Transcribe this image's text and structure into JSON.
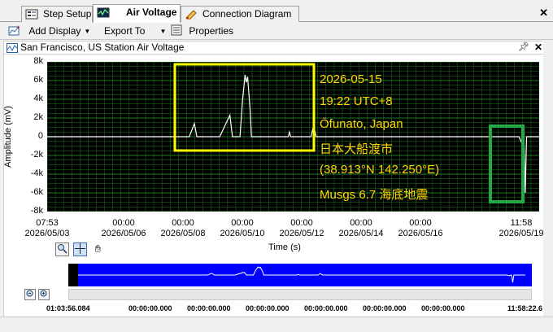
{
  "tabs": [
    {
      "label": "Step Setup",
      "icon": "step-setup-icon",
      "active": false
    },
    {
      "label": "Air Voltage",
      "icon": "air-voltage-icon",
      "active": true
    },
    {
      "label": "Connection Diagram",
      "icon": "connection-diagram-icon",
      "active": false
    }
  ],
  "toolbar": {
    "add_display": "Add Display",
    "export_to": "Export To",
    "properties": "Properties"
  },
  "panel": {
    "title": "San Francisco, US Station Air Voltage"
  },
  "chart_data": {
    "type": "line",
    "xlabel": "Time (s)",
    "ylabel": "Amplitude (mV)",
    "ylim": [
      -8000,
      8000
    ],
    "y_ticks": [
      "8k",
      "6k",
      "4k",
      "2k",
      "0",
      "-2k",
      "-4k",
      "-6k",
      "-8k"
    ],
    "x_ticks": [
      {
        "time": "07:53",
        "date": "2026/05/03"
      },
      {
        "time": "00:00",
        "date": "2026/05/06"
      },
      {
        "time": "00:00",
        "date": "2026/05/08"
      },
      {
        "time": "00:00",
        "date": "2026/05/10"
      },
      {
        "time": "00:00",
        "date": "2026/05/12"
      },
      {
        "time": "00:00",
        "date": "2026/05/14"
      },
      {
        "time": "00:00",
        "date": "2026/05/16"
      },
      {
        "time": "11:58",
        "date": "2026/05/19"
      }
    ],
    "grid": true,
    "line_color": "#ffffff",
    "background": "#000000",
    "grid_color": "#1f7a1f",
    "series": [
      {
        "points": [
          [
            "2026-05-03 07:53",
            0
          ],
          [
            "2026-05-05 00:00",
            0
          ],
          [
            "2026-05-08 00:00",
            0
          ],
          [
            "2026-05-08 04:00",
            1400
          ],
          [
            "2026-05-08 06:00",
            0
          ],
          [
            "2026-05-09 00:00",
            0
          ],
          [
            "2026-05-09 08:00",
            2300
          ],
          [
            "2026-05-09 10:00",
            0
          ],
          [
            "2026-05-09 16:00",
            0
          ],
          [
            "2026-05-09 18:00",
            4000
          ],
          [
            "2026-05-09 20:00",
            6600
          ],
          [
            "2026-05-09 21:00",
            5800
          ],
          [
            "2026-05-09 22:00",
            6400
          ],
          [
            "2026-05-10 00:00",
            2800
          ],
          [
            "2026-05-10 01:00",
            0
          ],
          [
            "2026-05-11 06:00",
            0
          ],
          [
            "2026-05-11 07:00",
            500
          ],
          [
            "2026-05-11 08:00",
            0
          ],
          [
            "2026-05-12 00:00",
            0
          ],
          [
            "2026-05-12 02:00",
            1200
          ],
          [
            "2026-05-12 04:00",
            0
          ],
          [
            "2026-05-18 20:00",
            0
          ],
          [
            "2026-05-18 22:00",
            -600
          ],
          [
            "2026-05-19 00:00",
            0
          ],
          [
            "2026-05-19 01:00",
            -6000
          ],
          [
            "2026-05-19 02:00",
            0
          ],
          [
            "2026-05-19 11:58",
            0
          ]
        ]
      }
    ]
  },
  "annotation": {
    "date": "2026-05-15",
    "time": "19:22 UTC+8",
    "place": "Ōfunato, Japan",
    "place_jp": "日本大船渡市",
    "coords": "(38.913°N 142.250°E)",
    "event": "Musgs 6.7 海底地震",
    "box_color": "#ffff00",
    "marker_color": "#22aa44"
  },
  "overview_ticks": [
    "01:03:56.084",
    "00:00:00.000",
    "00:00:00.000",
    "00:00:00.000",
    "00:00:00.000",
    "00:00:00.000",
    "00:00:00.000",
    "11:58:22.6"
  ]
}
